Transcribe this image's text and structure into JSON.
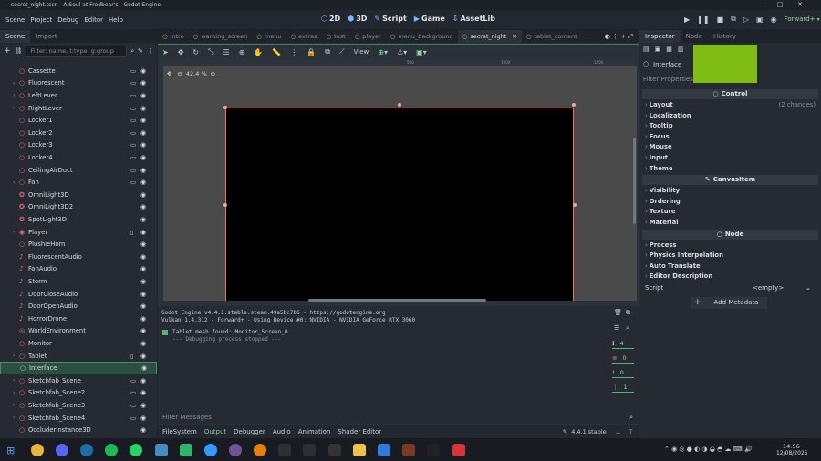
{
  "window": {
    "title": "secret_night.tscn - A Soul at Fredbear's - Godot Engine"
  },
  "menu": {
    "items": [
      "Scene",
      "Project",
      "Debug",
      "Editor",
      "Help"
    ]
  },
  "workspaces": [
    "2D",
    "3D",
    "Script",
    "Game",
    "AssetLib"
  ],
  "renderer": "Forward+",
  "left_panel": {
    "tabs": [
      "Scene",
      "Import"
    ],
    "filter_placeholder": "Filter: name, t:type, g:group",
    "nodes": [
      {
        "name": "Cassette",
        "icon": "node3d",
        "color": "#e86e6e",
        "extra": "film"
      },
      {
        "name": "Fluorescent",
        "icon": "node3d",
        "color": "#e86e6e",
        "extra": "film",
        "arrow": true
      },
      {
        "name": "LeftLever",
        "icon": "node3d",
        "color": "#e86e6e",
        "extra": "film",
        "arrow": true
      },
      {
        "name": "RightLever",
        "icon": "node3d",
        "color": "#e86e6e",
        "extra": "film",
        "arrow": true
      },
      {
        "name": "Locker1",
        "icon": "node3d",
        "color": "#e86e6e",
        "extra": "film"
      },
      {
        "name": "Locker2",
        "icon": "node3d",
        "color": "#e86e6e",
        "extra": "film"
      },
      {
        "name": "Locker3",
        "icon": "node3d",
        "color": "#e86e6e",
        "extra": "film"
      },
      {
        "name": "Locker4",
        "icon": "node3d",
        "color": "#e86e6e",
        "extra": "film"
      },
      {
        "name": "CeilingAirDuct",
        "icon": "node3d",
        "color": "#e86e6e",
        "extra": "film"
      },
      {
        "name": "Fan",
        "icon": "node3d",
        "color": "#e86e6e",
        "extra": "film",
        "arrow": true
      },
      {
        "name": "OmniLight3D",
        "icon": "light",
        "color": "#e86e6e"
      },
      {
        "name": "OmniLight3D2",
        "icon": "light",
        "color": "#e86e6e"
      },
      {
        "name": "SpotLight3D",
        "icon": "light",
        "color": "#e86e6e"
      },
      {
        "name": "Player",
        "icon": "player",
        "color": "#e86e6e",
        "extra": "script",
        "arrow": true
      },
      {
        "name": "PlushieHorn",
        "icon": "node3d",
        "color": "#e86e6e"
      },
      {
        "name": "FluorescentAudio",
        "icon": "audio",
        "color": "#e86e6e"
      },
      {
        "name": "FanAudio",
        "icon": "audio",
        "color": "#e86e6e"
      },
      {
        "name": "Storm",
        "icon": "audio",
        "color": "#e86e6e"
      },
      {
        "name": "DoorCloseAudio",
        "icon": "audio",
        "color": "#e86e6e"
      },
      {
        "name": "DoorOpenAudio",
        "icon": "audio",
        "color": "#e86e6e"
      },
      {
        "name": "HorrorDrone",
        "icon": "audio",
        "color": "#e86e6e"
      },
      {
        "name": "WorldEnvironment",
        "icon": "world",
        "color": "#e86e6e"
      },
      {
        "name": "Monitor",
        "icon": "node3d",
        "color": "#e86e6e"
      },
      {
        "name": "Tablet",
        "icon": "node3d",
        "color": "#e86e6e",
        "extra": "script",
        "arrow": true
      },
      {
        "name": "Interface",
        "icon": "control",
        "color": "#8dd89a",
        "selected": true
      },
      {
        "name": "Sketchfab_Scene",
        "icon": "node3d",
        "color": "#e86e6e",
        "extra": "film",
        "arrow": true
      },
      {
        "name": "Sketchfab_Scene2",
        "icon": "node3d",
        "color": "#e86e6e",
        "extra": "film",
        "arrow": true
      },
      {
        "name": "Sketchfab_Scene3",
        "icon": "node3d",
        "color": "#e86e6e",
        "extra": "film",
        "arrow": true
      },
      {
        "name": "Sketchfab_Scene4",
        "icon": "node3d",
        "color": "#e86e6e",
        "extra": "film",
        "arrow": true
      },
      {
        "name": "OccluderInstance3D",
        "icon": "node3d",
        "color": "#e86e6e"
      }
    ]
  },
  "scene_tabs": [
    "intro",
    "warning_screen",
    "menu",
    "extras",
    "test",
    "player",
    "menu_background",
    "secret_night",
    "tablet_content"
  ],
  "active_scene_tab": "secret_night",
  "toolbar": {
    "view_label": "View"
  },
  "viewport": {
    "zoom": "42.4 %",
    "ruler_labels": [
      "500",
      "1000",
      "1500"
    ]
  },
  "output": {
    "lines": [
      "Godot Engine v4.4.1.stable.steam.49a5bc7b6 - https://godotengine.org",
      "Vulkan 1.4.312 - Forward+ - Using Device #0: NVIDIA - NVIDIA GeForce RTX 3060",
      "Tablet mesh found: Monitor_Screen_0",
      "--- Debugging process stopped ---"
    ],
    "counts": {
      "messages": "4",
      "errors": "0",
      "warnings": "0",
      "editor": "1"
    },
    "filter_placeholder": "Filter Messages"
  },
  "bottom_tabs": [
    "FileSystem",
    "Output",
    "Debugger",
    "Audio",
    "Animation",
    "Shader Editor"
  ],
  "active_bottom_tab": "Output",
  "version": "4.4.1.stable",
  "inspector": {
    "tabs": [
      "Inspector",
      "Node",
      "History"
    ],
    "node_name": "Interface",
    "filter_placeholder": "Filter Properties",
    "sections": {
      "control": "Control",
      "canvas_item": "CanvasItem",
      "node": "Node"
    },
    "control_props": [
      "Layout",
      "Localization",
      "Tooltip",
      "Focus",
      "Mouse",
      "Input",
      "Theme"
    ],
    "layout_changes": "(2 changes)",
    "canvas_props": [
      "Visibility",
      "Ordering",
      "Texture",
      "Material"
    ],
    "node_props": [
      "Process",
      "Physics Interpolation",
      "Auto Translate",
      "Editor Description"
    ],
    "script_label": "Script",
    "script_value": "<empty>",
    "add_metadata": "Add Metadata"
  },
  "taskbar": {
    "time": "14:56",
    "date": "12/08/2025"
  }
}
